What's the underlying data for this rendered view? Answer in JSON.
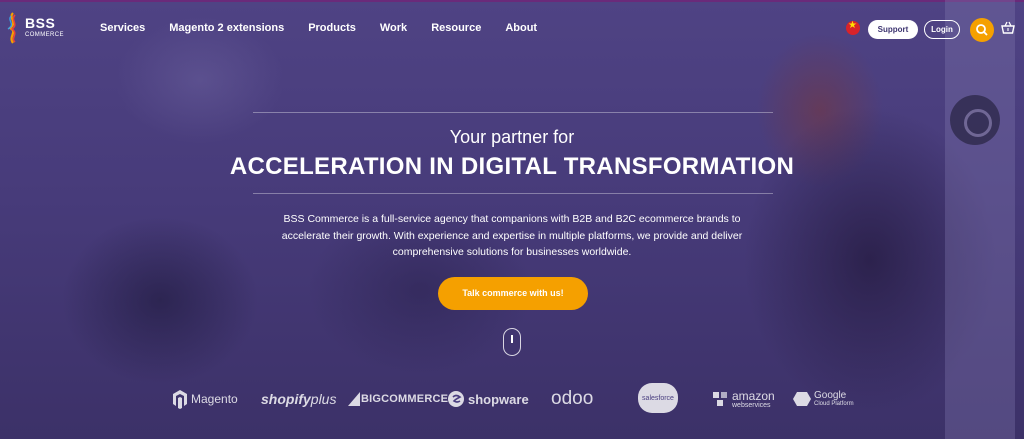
{
  "brand": {
    "name": "BSS",
    "subtitle": "COMMERCE"
  },
  "nav": {
    "items": [
      {
        "label": "Services"
      },
      {
        "label": "Magento 2 extensions"
      },
      {
        "label": "Products"
      },
      {
        "label": "Work"
      },
      {
        "label": "Resource"
      },
      {
        "label": "About"
      }
    ]
  },
  "header": {
    "support_label": "Support",
    "login_label": "Login",
    "flag_icon": "vietnam-flag-icon",
    "search_icon": "search-icon",
    "cart_icon": "basket-icon"
  },
  "hero": {
    "tagline": "Your partner for",
    "headline": "ACCELERATION IN DIGITAL TRANSFORMATION",
    "description": "BSS Commerce is a full-service agency that companions with B2B and B2C ecommerce brands to accelerate their growth. With experience and expertise in multiple platforms, we provide and deliver comprehensive solutions for businesses worldwide.",
    "cta_label": "Talk commerce with us!"
  },
  "partners": {
    "magento": "Magento",
    "shopify_bold": "shopify",
    "shopify_light": "plus",
    "bigcommerce": "BIGCOMMERCE",
    "shopware": "shopware",
    "odoo": "odoo",
    "salesforce": "salesforce",
    "amazon": "amazon",
    "amazon_sub": "webservices",
    "google": "Google",
    "google_sub": "Cloud Platform"
  },
  "colors": {
    "accent": "#f5a000",
    "overlay": "#4a3e80",
    "support_text": "#3d3470"
  }
}
